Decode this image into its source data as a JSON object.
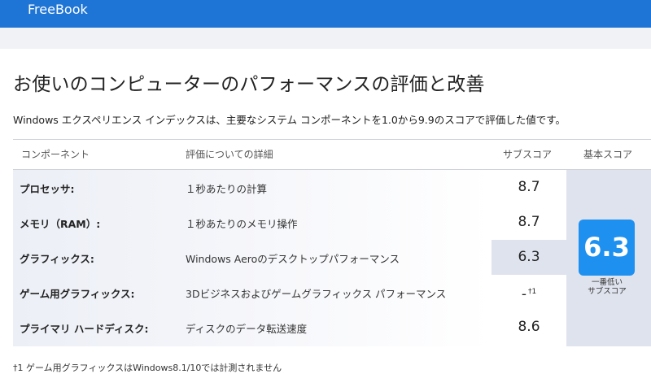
{
  "app": {
    "title": "FreeBook"
  },
  "page": {
    "title": "お使いのコンピューターのパフォーマンスの評価と改善",
    "description": "Windows エクスペリエンス インデックスは、主要なシステム コンポーネントを1.0から9.9のスコアで評価した値です。"
  },
  "table": {
    "headers": {
      "component": "コンポーネント",
      "detail": "評価についての詳細",
      "subscore": "サブスコア",
      "base": "基本スコア"
    },
    "rows": [
      {
        "name": "プロセッサ:",
        "detail": "１秒あたりの計算",
        "score": "8.7",
        "note": ""
      },
      {
        "name": "メモリ（RAM）:",
        "detail": "１秒あたりのメモリ操作",
        "score": "8.7",
        "note": ""
      },
      {
        "name": "グラフィックス:",
        "detail": "Windows Aeroのデスクトップパフォーマンス",
        "score": "6.3",
        "note": ""
      },
      {
        "name": "ゲーム用グラフィックス:",
        "detail": "3Dビジネスおよびゲームグラフィックス パフォーマンス",
        "score": "-",
        "note": "†1"
      },
      {
        "name": "プライマリ ハードディスク:",
        "detail": "ディスクのデータ転送速度",
        "score": "8.6",
        "note": ""
      }
    ],
    "lowest_row": "グラフィックス:",
    "base_score": "6.3",
    "base_caption_line1": "一番低い",
    "base_caption_line2": "サブスコア"
  },
  "footnote": "†1 ゲーム用グラフィックスはWindows8.1/10では計測されません",
  "colors": {
    "header_bar": "#1f75d6",
    "base_score_tile": "#1e90ef",
    "highlight": "#dfe3ee"
  }
}
